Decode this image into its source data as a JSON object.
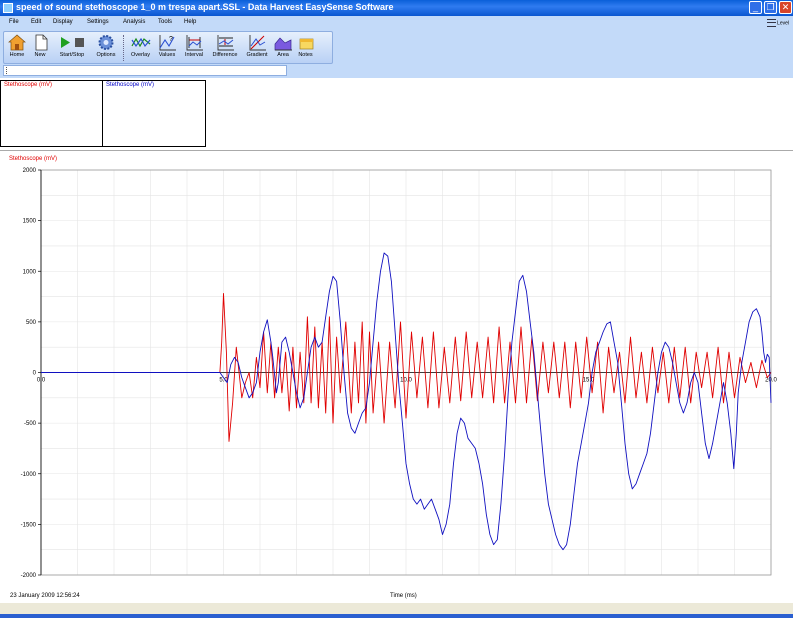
{
  "window": {
    "title": "speed of sound stethoscope 1_0 m trespa apart.SSL - Data Harvest EasySense Software",
    "buttons": [
      "_",
      "❐",
      "✕"
    ]
  },
  "menu": [
    "File",
    "Edit",
    "Display",
    "Settings",
    "Analysis",
    "Tools",
    "Help"
  ],
  "level_label": "Level",
  "toolbar": [
    {
      "label": "Home",
      "icon": "home-icon"
    },
    {
      "label": "New",
      "icon": "new-document-icon"
    },
    {
      "label": "Start/Stop",
      "icon": "play-stop-icon"
    },
    {
      "label": "Options",
      "icon": "gear-icon"
    },
    {
      "label": "Overlay",
      "icon": "overlay-icon"
    },
    {
      "label": "Values",
      "icon": "values-icon"
    },
    {
      "label": "Interval",
      "icon": "interval-icon"
    },
    {
      "label": "Difference",
      "icon": "difference-icon"
    },
    {
      "label": "Gradient",
      "icon": "gradient-icon"
    },
    {
      "label": "Area",
      "icon": "area-icon"
    },
    {
      "label": "Notes",
      "icon": "notes-icon"
    }
  ],
  "value_panels": [
    {
      "label": "Stethoscope (mV)",
      "color": "#e00000"
    },
    {
      "label": "Stethoscope (mV)",
      "color": "#0000c8"
    }
  ],
  "colors": {
    "red_series": "#e00000",
    "blue_series": "#1010c0"
  },
  "chart_data": {
    "type": "line",
    "ylabel": "Stethoscope (mV)",
    "xlabel": "Time (ms)",
    "xlim": [
      0,
      20
    ],
    "ylim": [
      -2000,
      2000
    ],
    "x_ticks": [
      "0.0",
      "5.0",
      "10.0",
      "15.0",
      "20.0"
    ],
    "y_ticks": [
      "2000",
      "1500",
      "1000",
      "500",
      "0",
      "-500",
      "-1000",
      "-1500",
      "-2000"
    ],
    "grid": true,
    "timestamp": "23 January 2009  12:56:24",
    "series": [
      {
        "color": "red",
        "points": [
          [
            0,
            0
          ],
          [
            4.9,
            0
          ],
          [
            4.95,
            300
          ],
          [
            5.0,
            780
          ],
          [
            5.08,
            200
          ],
          [
            5.15,
            -680
          ],
          [
            5.25,
            -300
          ],
          [
            5.35,
            250
          ],
          [
            5.5,
            -250
          ],
          [
            5.6,
            -100
          ],
          [
            5.7,
            0
          ],
          [
            5.8,
            -250
          ],
          [
            5.9,
            150
          ],
          [
            6.0,
            -150
          ],
          [
            6.1,
            400
          ],
          [
            6.2,
            -200
          ],
          [
            6.3,
            300
          ],
          [
            6.4,
            -250
          ],
          [
            6.5,
            250
          ],
          [
            6.6,
            -200
          ],
          [
            6.7,
            200
          ],
          [
            6.8,
            -380
          ],
          [
            6.9,
            250
          ],
          [
            7.0,
            -350
          ],
          [
            7.1,
            200
          ],
          [
            7.2,
            -300
          ],
          [
            7.3,
            550
          ],
          [
            7.4,
            -300
          ],
          [
            7.5,
            450
          ],
          [
            7.6,
            -350
          ],
          [
            7.7,
            300
          ],
          [
            7.8,
            -400
          ],
          [
            7.9,
            550
          ],
          [
            8.0,
            -500
          ],
          [
            8.1,
            350
          ],
          [
            8.2,
            -200
          ],
          [
            8.35,
            500
          ],
          [
            8.5,
            -400
          ],
          [
            8.6,
            300
          ],
          [
            8.7,
            -300
          ],
          [
            8.8,
            500
          ],
          [
            8.9,
            -500
          ],
          [
            9.0,
            400
          ],
          [
            9.1,
            -400
          ],
          [
            9.25,
            300
          ],
          [
            9.4,
            -500
          ],
          [
            9.55,
            300
          ],
          [
            9.7,
            -350
          ],
          [
            9.85,
            500
          ],
          [
            10.0,
            -450
          ],
          [
            10.15,
            400
          ],
          [
            10.3,
            -250
          ],
          [
            10.45,
            350
          ],
          [
            10.6,
            -350
          ],
          [
            10.75,
            400
          ],
          [
            10.9,
            -350
          ],
          [
            11.05,
            250
          ],
          [
            11.2,
            -300
          ],
          [
            11.35,
            350
          ],
          [
            11.5,
            -280
          ],
          [
            11.65,
            400
          ],
          [
            11.8,
            -250
          ],
          [
            11.95,
            300
          ],
          [
            12.1,
            -250
          ],
          [
            12.25,
            350
          ],
          [
            12.4,
            -300
          ],
          [
            12.55,
            450
          ],
          [
            12.7,
            -300
          ],
          [
            12.85,
            300
          ],
          [
            13.0,
            -300
          ],
          [
            13.15,
            450
          ],
          [
            13.3,
            -300
          ],
          [
            13.45,
            350
          ],
          [
            13.6,
            -280
          ],
          [
            13.75,
            300
          ],
          [
            13.9,
            -200
          ],
          [
            14.05,
            300
          ],
          [
            14.2,
            -250
          ],
          [
            14.35,
            300
          ],
          [
            14.5,
            -350
          ],
          [
            14.65,
            300
          ],
          [
            14.8,
            -250
          ],
          [
            14.95,
            350
          ],
          [
            15.1,
            -200
          ],
          [
            15.25,
            300
          ],
          [
            15.4,
            -400
          ],
          [
            15.55,
            250
          ],
          [
            15.7,
            -200
          ],
          [
            15.85,
            200
          ],
          [
            16.0,
            -300
          ],
          [
            16.15,
            350
          ],
          [
            16.3,
            -250
          ],
          [
            16.45,
            200
          ],
          [
            16.6,
            -300
          ],
          [
            16.75,
            250
          ],
          [
            16.9,
            -200
          ],
          [
            17.05,
            200
          ],
          [
            17.2,
            -300
          ],
          [
            17.35,
            250
          ],
          [
            17.5,
            -250
          ],
          [
            17.65,
            250
          ],
          [
            17.8,
            -300
          ],
          [
            17.95,
            200
          ],
          [
            18.1,
            -150
          ],
          [
            18.25,
            200
          ],
          [
            18.4,
            -250
          ],
          [
            18.55,
            250
          ],
          [
            18.7,
            -300
          ],
          [
            18.85,
            200
          ],
          [
            19.0,
            -250
          ],
          [
            19.15,
            150
          ],
          [
            19.3,
            -100
          ],
          [
            19.45,
            100
          ],
          [
            19.6,
            -150
          ],
          [
            19.75,
            120
          ],
          [
            19.9,
            -50
          ],
          [
            20.0,
            0
          ]
        ]
      },
      {
        "color": "blue",
        "points": [
          [
            0,
            0
          ],
          [
            4.9,
            0
          ],
          [
            5.0,
            -50
          ],
          [
            5.1,
            -100
          ],
          [
            5.2,
            80
          ],
          [
            5.3,
            150
          ],
          [
            5.4,
            100
          ],
          [
            5.5,
            -50
          ],
          [
            5.6,
            -150
          ],
          [
            5.7,
            -250
          ],
          [
            5.8,
            -200
          ],
          [
            5.9,
            -100
          ],
          [
            6.0,
            200
          ],
          [
            6.1,
            400
          ],
          [
            6.2,
            520
          ],
          [
            6.3,
            300
          ],
          [
            6.35,
            150
          ],
          [
            6.45,
            -200
          ],
          [
            6.5,
            -100
          ],
          [
            6.6,
            300
          ],
          [
            6.7,
            350
          ],
          [
            6.8,
            200
          ],
          [
            6.9,
            0
          ],
          [
            7.0,
            -200
          ],
          [
            7.1,
            -350
          ],
          [
            7.2,
            -250
          ],
          [
            7.3,
            0
          ],
          [
            7.4,
            250
          ],
          [
            7.5,
            350
          ],
          [
            7.6,
            250
          ],
          [
            7.7,
            300
          ],
          [
            7.8,
            550
          ],
          [
            7.9,
            800
          ],
          [
            8.0,
            950
          ],
          [
            8.1,
            900
          ],
          [
            8.2,
            500
          ],
          [
            8.3,
            0
          ],
          [
            8.4,
            -400
          ],
          [
            8.5,
            -550
          ],
          [
            8.6,
            -600
          ],
          [
            8.7,
            -500
          ],
          [
            8.8,
            -400
          ],
          [
            8.9,
            -350
          ],
          [
            9.0,
            -100
          ],
          [
            9.1,
            300
          ],
          [
            9.2,
            700
          ],
          [
            9.3,
            1000
          ],
          [
            9.4,
            1180
          ],
          [
            9.5,
            1150
          ],
          [
            9.6,
            900
          ],
          [
            9.7,
            400
          ],
          [
            9.8,
            -100
          ],
          [
            9.9,
            -500
          ],
          [
            10.0,
            -900
          ],
          [
            10.1,
            -1100
          ],
          [
            10.2,
            -1250
          ],
          [
            10.3,
            -1300
          ],
          [
            10.4,
            -1250
          ],
          [
            10.5,
            -1350
          ],
          [
            10.6,
            -1300
          ],
          [
            10.7,
            -1250
          ],
          [
            10.8,
            -1350
          ],
          [
            10.9,
            -1450
          ],
          [
            11.0,
            -1600
          ],
          [
            11.1,
            -1500
          ],
          [
            11.2,
            -1300
          ],
          [
            11.3,
            -900
          ],
          [
            11.4,
            -600
          ],
          [
            11.5,
            -450
          ],
          [
            11.6,
            -500
          ],
          [
            11.7,
            -650
          ],
          [
            11.8,
            -700
          ],
          [
            11.9,
            -750
          ],
          [
            12.0,
            -900
          ],
          [
            12.1,
            -1100
          ],
          [
            12.2,
            -1400
          ],
          [
            12.3,
            -1600
          ],
          [
            12.4,
            -1700
          ],
          [
            12.5,
            -1650
          ],
          [
            12.6,
            -1300
          ],
          [
            12.7,
            -800
          ],
          [
            12.8,
            -200
          ],
          [
            12.9,
            300
          ],
          [
            13.0,
            600
          ],
          [
            13.1,
            900
          ],
          [
            13.2,
            960
          ],
          [
            13.3,
            800
          ],
          [
            13.4,
            500
          ],
          [
            13.5,
            200
          ],
          [
            13.6,
            -200
          ],
          [
            13.7,
            -600
          ],
          [
            13.8,
            -1000
          ],
          [
            13.9,
            -1300
          ],
          [
            14.0,
            -1450
          ],
          [
            14.1,
            -1600
          ],
          [
            14.2,
            -1700
          ],
          [
            14.3,
            -1750
          ],
          [
            14.4,
            -1700
          ],
          [
            14.5,
            -1500
          ],
          [
            14.6,
            -1200
          ],
          [
            14.7,
            -900
          ],
          [
            14.8,
            -700
          ],
          [
            14.9,
            -500
          ],
          [
            15.0,
            -300
          ],
          [
            15.1,
            0
          ],
          [
            15.2,
            200
          ],
          [
            15.3,
            300
          ],
          [
            15.4,
            400
          ],
          [
            15.5,
            480
          ],
          [
            15.6,
            500
          ],
          [
            15.7,
            300
          ],
          [
            15.8,
            100
          ],
          [
            15.9,
            -300
          ],
          [
            16.0,
            -700
          ],
          [
            16.1,
            -1000
          ],
          [
            16.2,
            -1150
          ],
          [
            16.3,
            -1100
          ],
          [
            16.4,
            -1000
          ],
          [
            16.5,
            -900
          ],
          [
            16.6,
            -800
          ],
          [
            16.7,
            -600
          ],
          [
            16.8,
            -300
          ],
          [
            16.9,
            0
          ],
          [
            17.0,
            200
          ],
          [
            17.1,
            300
          ],
          [
            17.2,
            250
          ],
          [
            17.3,
            100
          ],
          [
            17.4,
            -100
          ],
          [
            17.5,
            -300
          ],
          [
            17.6,
            -400
          ],
          [
            17.7,
            -300
          ],
          [
            17.8,
            -100
          ],
          [
            17.9,
            0
          ],
          [
            18.0,
            -100
          ],
          [
            18.1,
            -400
          ],
          [
            18.2,
            -700
          ],
          [
            18.3,
            -850
          ],
          [
            18.4,
            -700
          ],
          [
            18.5,
            -500
          ],
          [
            18.6,
            -300
          ],
          [
            18.7,
            -100
          ],
          [
            18.8,
            -300
          ],
          [
            18.9,
            -600
          ],
          [
            18.98,
            -950
          ],
          [
            19.05,
            -600
          ],
          [
            19.1,
            -200
          ],
          [
            19.2,
            100
          ],
          [
            19.3,
            300
          ],
          [
            19.4,
            500
          ],
          [
            19.5,
            600
          ],
          [
            19.6,
            630
          ],
          [
            19.7,
            550
          ],
          [
            19.75,
            400
          ],
          [
            19.8,
            200
          ],
          [
            19.85,
            100
          ],
          [
            19.9,
            180
          ],
          [
            19.95,
            150
          ],
          [
            20.0,
            -300
          ]
        ]
      }
    ]
  }
}
